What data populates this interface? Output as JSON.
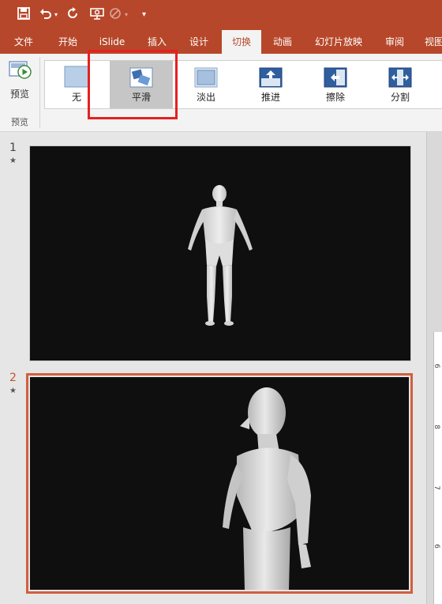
{
  "qat": {
    "icons": [
      "save-icon",
      "undo-icon",
      "undo-dropdown-icon",
      "redo-icon",
      "present-icon",
      "disabled-icon",
      "more-icon",
      "customize-icon"
    ]
  },
  "tabs": [
    {
      "label": "文件"
    },
    {
      "label": "开始"
    },
    {
      "label": "iSlide"
    },
    {
      "label": "插入"
    },
    {
      "label": "设计"
    },
    {
      "label": "切换"
    },
    {
      "label": "动画"
    },
    {
      "label": "幻灯片放映"
    },
    {
      "label": "审阅"
    },
    {
      "label": "视图"
    }
  ],
  "active_tab": "切换",
  "ribbon": {
    "preview_label": "预览",
    "group_label": "预览",
    "transitions": [
      {
        "label": "无"
      },
      {
        "label": "平滑"
      },
      {
        "label": "淡出"
      },
      {
        "label": "推进"
      },
      {
        "label": "擦除"
      },
      {
        "label": "分割"
      }
    ],
    "selected": "平滑"
  },
  "slides": [
    {
      "number": "1",
      "star": "★"
    },
    {
      "number": "2",
      "star": "★"
    }
  ],
  "ruler_numbers": [
    "6",
    "8",
    "7",
    "6"
  ],
  "colors": {
    "accent": "#b7472a",
    "highlight_box": "#e62020",
    "active_slide_border": "#d25f3e"
  }
}
